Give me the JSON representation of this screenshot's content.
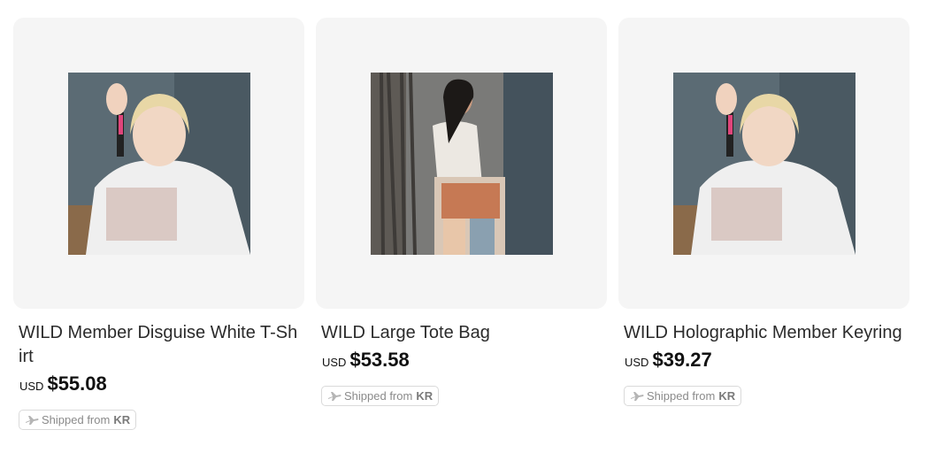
{
  "products": [
    {
      "title": "WILD Member Disguise White T-Shirt",
      "currency": "USD",
      "price": "$55.08",
      "shipping_prefix": "Shipped from",
      "shipping_country": "KR"
    },
    {
      "title": "WILD Large Tote Bag",
      "currency": "USD",
      "price": "$53.58",
      "shipping_prefix": "Shipped from",
      "shipping_country": "KR"
    },
    {
      "title": "WILD Holographic Member Keyring",
      "currency": "USD",
      "price": "$39.27",
      "shipping_prefix": "Shipped from",
      "shipping_country": "KR"
    }
  ],
  "colors": {
    "thumb_bg": "#f5f5f5",
    "text": "#2b2b2b",
    "price": "#111111",
    "badge_border": "#dadada",
    "badge_text": "#8a8a8a"
  },
  "icons": {
    "shipping": "airplane-icon"
  }
}
